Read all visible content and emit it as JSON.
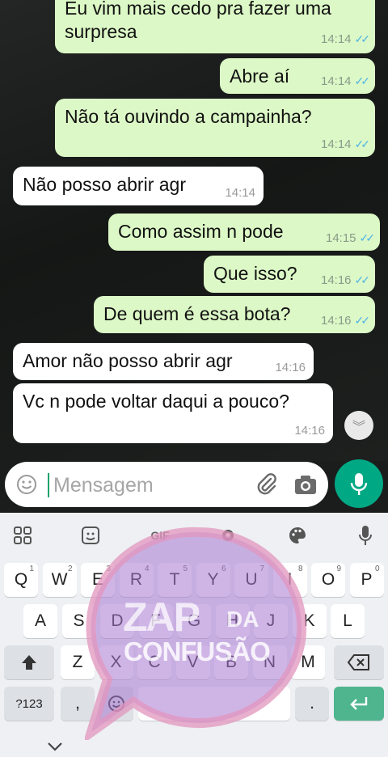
{
  "messages": [
    {
      "dir": "out",
      "text": "Eu vim mais cedo pra fazer uma\nsurpresa",
      "time": "14:14",
      "ticks": "✓✓"
    },
    {
      "dir": "out",
      "text": "Abre aí",
      "time": "14:14",
      "ticks": "✓✓"
    },
    {
      "dir": "out",
      "text": "Não tá ouvindo a campainha?",
      "time": "14:14",
      "ticks": "✓✓"
    },
    {
      "dir": "in",
      "text": "Não posso abrir agr",
      "time": "14:14"
    },
    {
      "dir": "out",
      "text": "Como assim n pode",
      "time": "14:15",
      "ticks": "✓✓"
    },
    {
      "dir": "out",
      "text": "Que isso?",
      "time": "14:16",
      "ticks": "✓✓"
    },
    {
      "dir": "out",
      "text": "De quem é essa bota?",
      "time": "14:16",
      "ticks": "✓✓"
    },
    {
      "dir": "in",
      "text": "Amor não posso abrir agr",
      "time": "14:16"
    },
    {
      "dir": "in",
      "text": "Vc n pode voltar daqui a pouco?",
      "time": "14:16"
    }
  ],
  "compose": {
    "placeholder": "Mensagem"
  },
  "icons": {
    "emoji": "emoji-icon",
    "attach": "paperclip-icon",
    "camera": "camera-icon",
    "mic": "mic-icon",
    "scroll": "chevron-down-icon"
  },
  "keyboard": {
    "toolbar": {
      "gif": "GIF"
    },
    "row1": [
      {
        "k": "Q",
        "n": "1"
      },
      {
        "k": "W",
        "n": "2"
      },
      {
        "k": "E",
        "n": "3"
      },
      {
        "k": "R",
        "n": "4"
      },
      {
        "k": "T",
        "n": "5"
      },
      {
        "k": "Y",
        "n": "6"
      },
      {
        "k": "U",
        "n": "7"
      },
      {
        "k": "I",
        "n": "8"
      },
      {
        "k": "O",
        "n": "9"
      },
      {
        "k": "P",
        "n": "0"
      }
    ],
    "row2": [
      "A",
      "S",
      "D",
      "F",
      "G",
      "H",
      "J",
      "K",
      "L"
    ],
    "row3": [
      "Z",
      "X",
      "C",
      "V",
      "B",
      "N",
      "M"
    ],
    "sym": "?123",
    "comma": ",",
    "period": "."
  },
  "watermark": {
    "line1": "ZAP",
    "line2": "DA",
    "line3": "CONFUSÃO"
  },
  "colors": {
    "outgoing": "#dcf8c6",
    "incoming": "#ffffff",
    "accent": "#00a884",
    "tick": "#4fb5e6"
  }
}
